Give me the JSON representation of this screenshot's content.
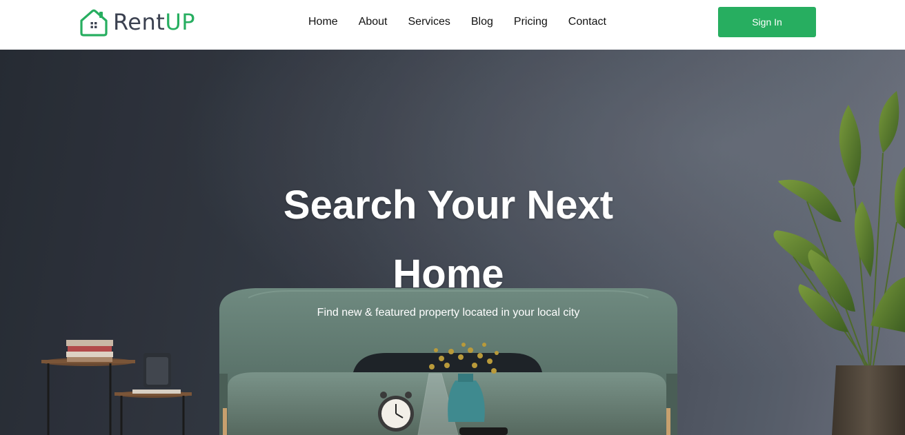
{
  "brand": {
    "name_part1": "Rent",
    "name_part2": "UP",
    "primary_color": "#27ae60",
    "dark_color": "#3b4150",
    "logo_icon": "house-icon"
  },
  "nav": {
    "items": [
      {
        "label": "Home"
      },
      {
        "label": "About"
      },
      {
        "label": "Services"
      },
      {
        "label": "Blog"
      },
      {
        "label": "Pricing"
      },
      {
        "label": "Contact"
      }
    ]
  },
  "header": {
    "signin_label": "Sign In"
  },
  "hero": {
    "title": "Search Your Next Home",
    "subtitle": "Find new & featured property located in your local city"
  }
}
